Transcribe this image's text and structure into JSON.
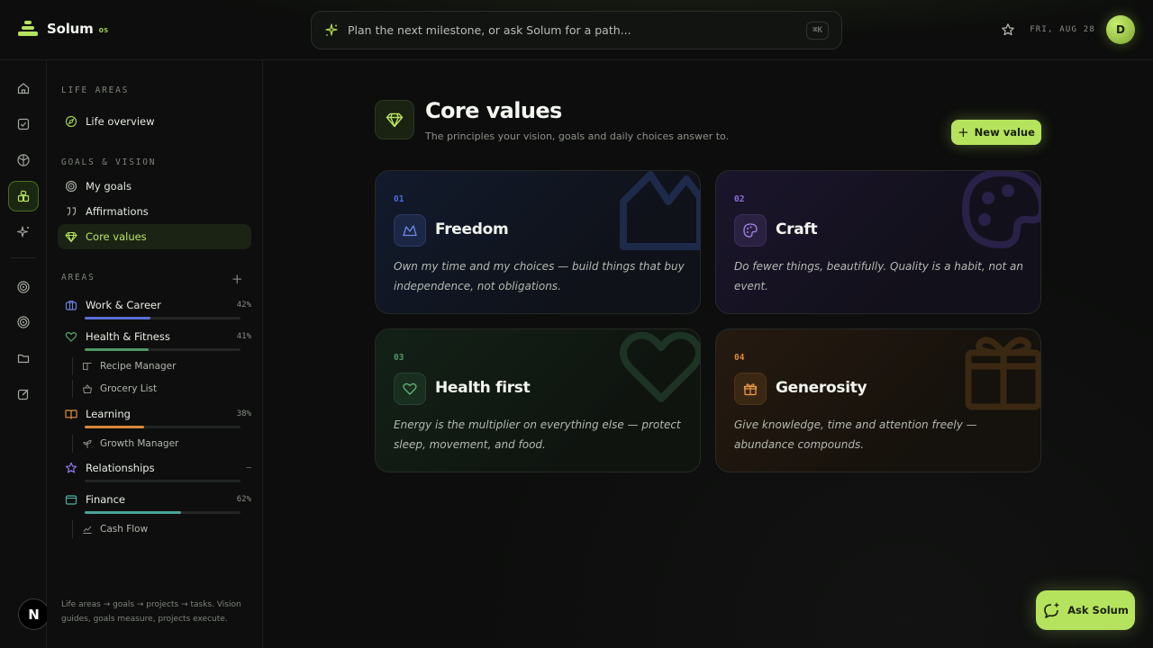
{
  "brand": {
    "name": "Solum",
    "suffix": "os"
  },
  "command": {
    "placeholder": "Plan the next milestone, or ask Solum for a path...",
    "shortcut": "⌘K"
  },
  "header": {
    "date": "FRI, AUG 28",
    "avatar_initial": "D"
  },
  "rail": {
    "badge": "N"
  },
  "sidebar": {
    "life_areas_label": "LIFE AREAS",
    "life_overview": "Life overview",
    "goals_vision_label": "GOALS & VISION",
    "goals_items": [
      {
        "label": "My goals",
        "icon": "target-icon"
      },
      {
        "label": "Affirmations",
        "icon": "quote-icon"
      },
      {
        "label": "Core values",
        "icon": "gem-icon"
      }
    ],
    "areas_label": "AREAS",
    "areas": [
      {
        "name": "Work & Career",
        "pct": "42%",
        "progress": 0.42,
        "color": "#5b6fd6"
      },
      {
        "name": "Health & Fitness",
        "pct": "41%",
        "progress": 0.41,
        "color": "#4f9a63"
      },
      {
        "name": "Learning",
        "pct": "38%",
        "progress": 0.38,
        "color": "#d9883a"
      },
      {
        "name": "Relationships",
        "pct": "–",
        "progress": 0,
        "color": "#8a66e0"
      },
      {
        "name": "Finance",
        "pct": "62%",
        "progress": 0.62,
        "color": "#4aa39a"
      }
    ],
    "sub_items": {
      "recipe_manager": "Recipe Manager",
      "grocery_list": "Grocery List",
      "growth_manager": "Growth Manager",
      "cash_flow": "Cash Flow"
    },
    "footnote": "Life areas → goals → projects → tasks. Vision guides, goals measure, projects execute."
  },
  "main": {
    "title": "Core values",
    "subtitle": "The principles your vision, goals and daily choices answer to.",
    "new_button": "New value",
    "cards": [
      {
        "num": "01",
        "title": "Freedom",
        "desc": "Own my time and my choices — build things that buy independence, not obligations.",
        "accent": "#4c6ad8"
      },
      {
        "num": "02",
        "title": "Craft",
        "desc": "Do fewer things, beautifully. Quality is a habit, not an event.",
        "accent": "#8e6ce0"
      },
      {
        "num": "03",
        "title": "Health first",
        "desc": "Energy is the multiplier on everything else — protect sleep, movement, and food.",
        "accent": "#4f9a63"
      },
      {
        "num": "04",
        "title": "Generosity",
        "desc": "Give knowledge, time and attention freely — abundance compounds.",
        "accent": "#d9883a"
      }
    ]
  },
  "ask_button": "Ask Solum",
  "colors": {
    "accent": "#b6e35d",
    "background": "#0c0d0c"
  }
}
